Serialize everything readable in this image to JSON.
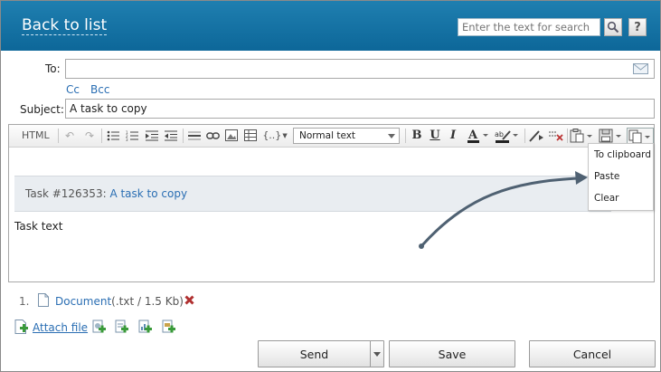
{
  "header": {
    "back_label": "Back to list",
    "search_placeholder": "Enter the text for search",
    "help_label": "?"
  },
  "form": {
    "to_label": "To:",
    "to_value": "",
    "cc_label": "Cc",
    "bcc_label": "Bcc",
    "subject_label": "Subject:",
    "subject_value": "A task to copy"
  },
  "toolbar": {
    "html_label": "HTML",
    "format_value": "Normal text",
    "insert_template_label": "{..}"
  },
  "dropdown": {
    "items": [
      "To clipboard",
      "Paste",
      "Clear"
    ]
  },
  "editor": {
    "quote_prefix": "Task #126353: ",
    "quote_link": "A task to copy",
    "body_text": "Task text"
  },
  "attachments": {
    "index": "1.",
    "name": "Document",
    "meta": "(.txt / 1.5 Kb)",
    "attach_label": "Attach file"
  },
  "actions": {
    "send_label": "Send",
    "save_label": "Save",
    "cancel_label": "Cancel"
  },
  "colors": {
    "header": "#1073a8",
    "link": "#2a6eb3",
    "arrow": "#4f6172",
    "remove": "#b03030"
  }
}
